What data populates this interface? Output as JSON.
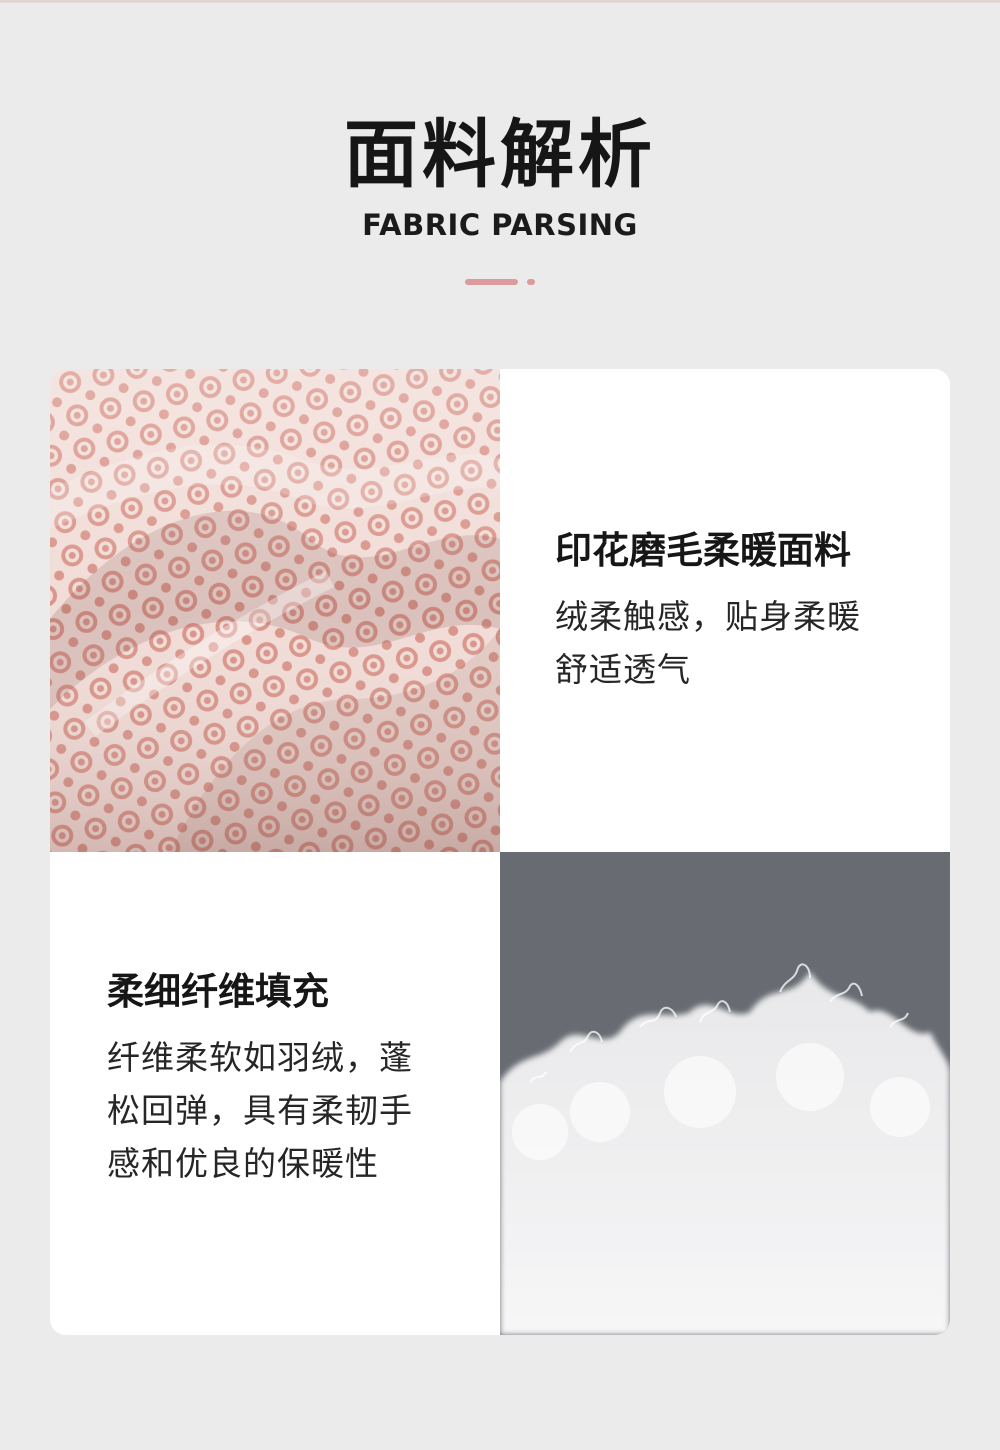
{
  "header": {
    "title": "面料解析",
    "subtitle": "FABRIC PARSING"
  },
  "colors": {
    "accent": "#dd9a9c",
    "background": "#ebebeb",
    "fabric_pink": "#d89a92",
    "fill_bg": "#686c72"
  },
  "features": [
    {
      "title": "印花磨毛柔暖面料",
      "desc_lines": [
        "绒柔触感，贴身柔暖",
        "舒适透气"
      ]
    },
    {
      "title": "柔细纤维填充",
      "desc_lines": [
        "纤维柔软如羽绒，蓬",
        "松回弹，具有柔韧手",
        "感和优良的保暖性"
      ]
    }
  ]
}
